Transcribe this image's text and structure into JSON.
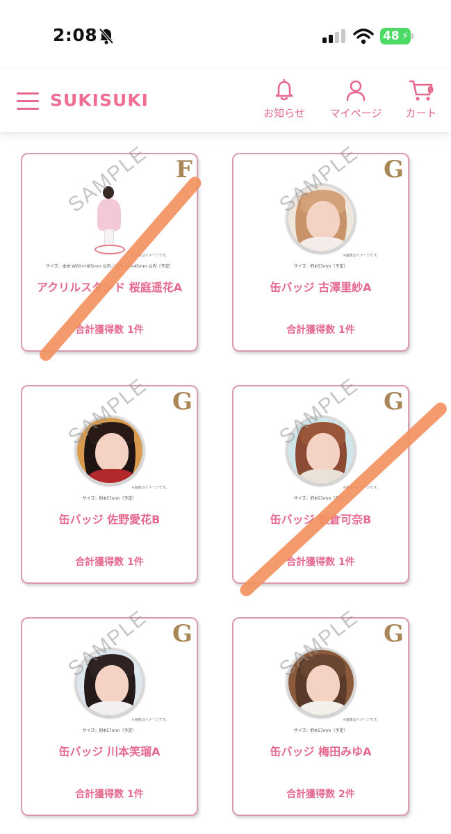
{
  "status": {
    "time": "2:08",
    "battery": "48"
  },
  "header": {
    "logo": "SUKISUKI",
    "notice_label": "お知らせ",
    "mypage_label": "マイページ",
    "cart_label": "カート",
    "cart_count": "0"
  },
  "colors": {
    "accent": "#e5698d",
    "rank_gold": "#a88656",
    "card_border": "#d89aac",
    "strike": "#f3905e"
  },
  "items": [
    {
      "rank": "F",
      "title": "アクリルスタンド 桜庭遥花A",
      "count": "合計獲得数 1件",
      "type": "acrylic-stand",
      "size": "サイズ：本体 W60×H85mm 以内／台座 45×45mm 以内（予定）",
      "note": "※画像はイメージです。",
      "sample": "SAMPLE",
      "crossed_out": true
    },
    {
      "rank": "G",
      "title": "缶バッジ 古澤里紗A",
      "count": "合計獲得数 1件",
      "type": "can-badge",
      "size": "サイズ：約Φ57mm（予定）",
      "note": "※画像はイメージです。",
      "sample": "SAMPLE",
      "crossed_out": false
    },
    {
      "rank": "G",
      "title": "缶バッジ 佐野愛花B",
      "count": "合計獲得数 1件",
      "type": "can-badge",
      "size": "サイズ：約Φ57mm（予定）",
      "note": "※画像はイメージです。",
      "sample": "SAMPLE",
      "crossed_out": false
    },
    {
      "rank": "G",
      "title": "缶バッジ 板倉可奈B",
      "count": "合計獲得数 1件",
      "type": "can-badge",
      "size": "サイズ：約Φ57mm（予定）",
      "note": "※画像はイメージです。",
      "sample": "SAMPLE",
      "crossed_out": true
    },
    {
      "rank": "G",
      "title": "缶バッジ 川本笑瑠A",
      "count": "合計獲得数 1件",
      "type": "can-badge",
      "size": "サイズ：約Φ57mm（予定）",
      "note": "※画像はイメージです。",
      "sample": "SAMPLE",
      "crossed_out": false
    },
    {
      "rank": "G",
      "title": "缶バッジ 梅田みゆA",
      "count": "合計獲得数 2件",
      "type": "can-badge",
      "size": "サイズ：約Φ57mm（予定）",
      "note": "※画像はイメージです。",
      "sample": "SAMPLE",
      "crossed_out": false
    }
  ]
}
